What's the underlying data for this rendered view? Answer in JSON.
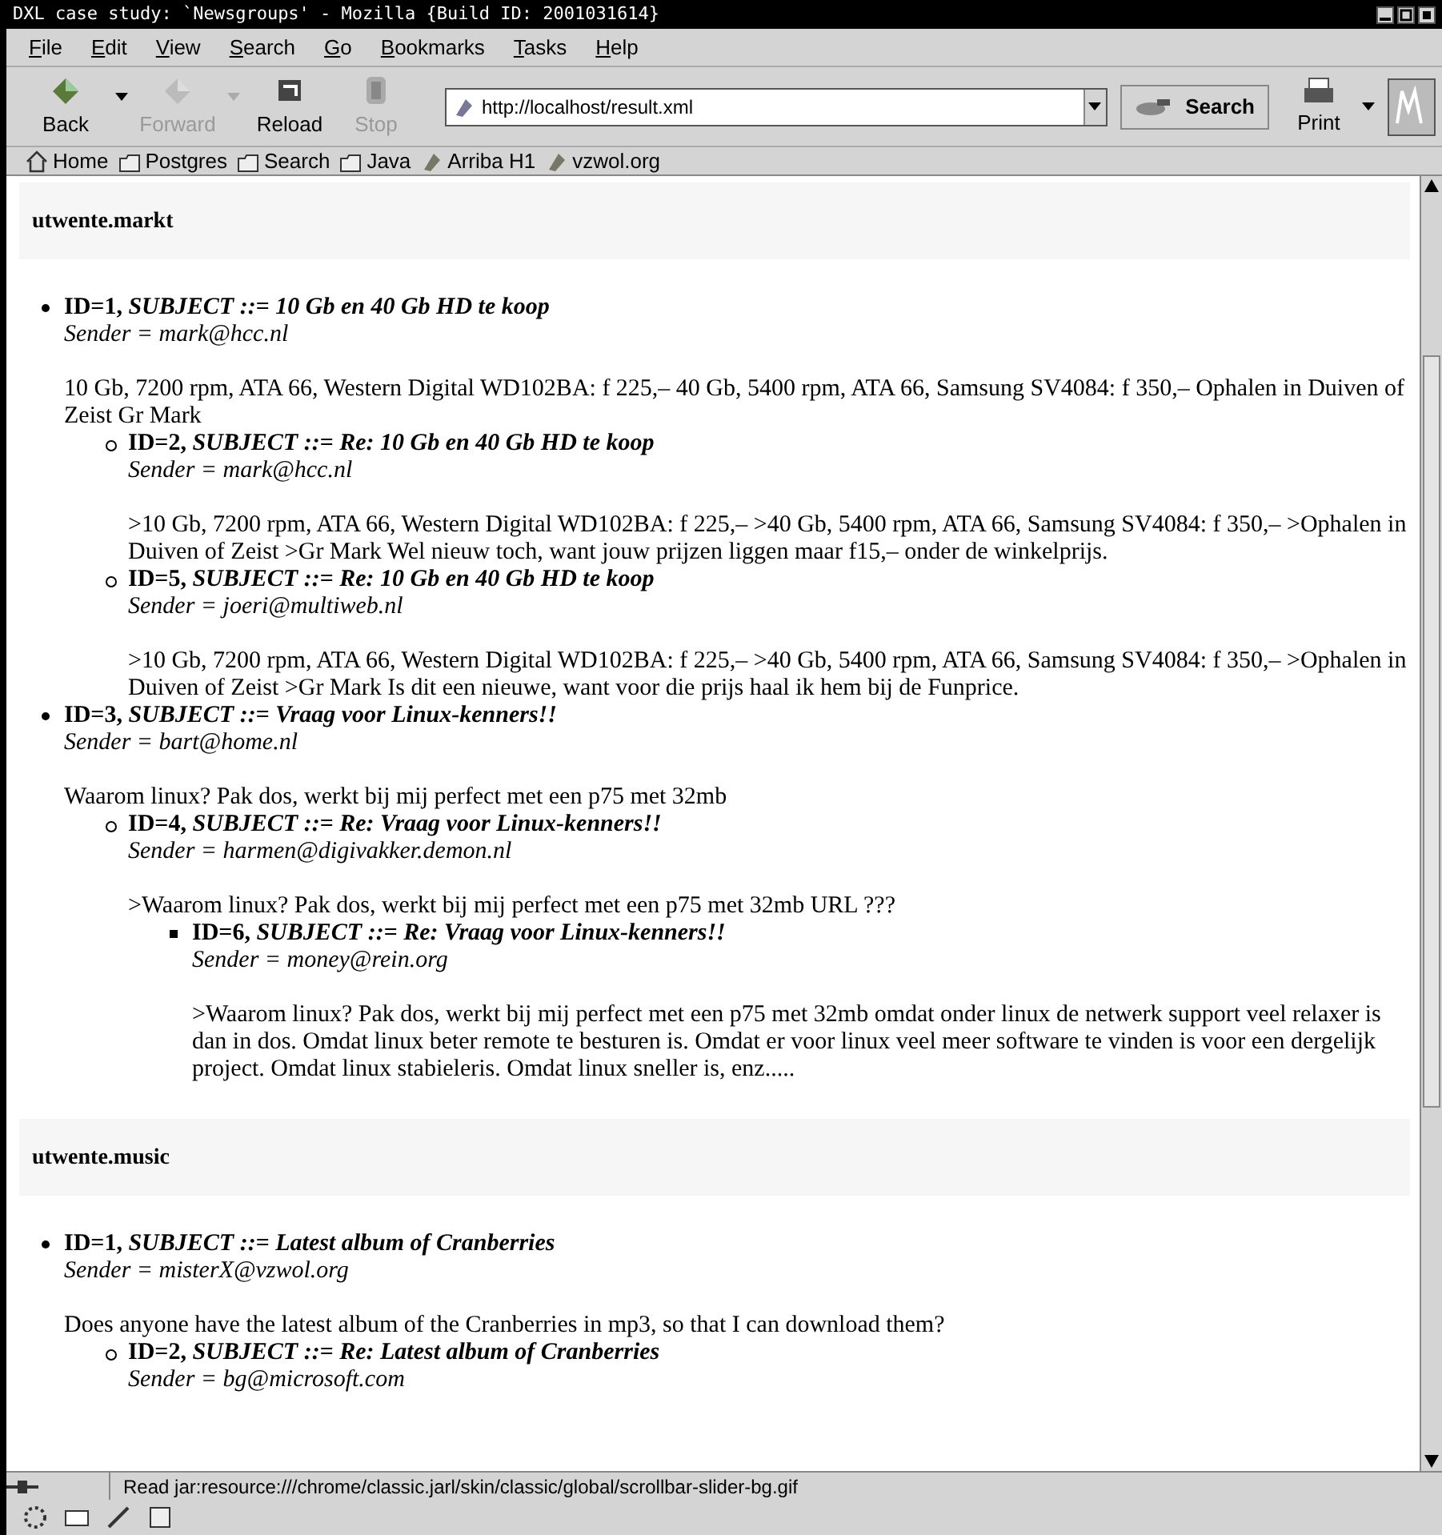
{
  "window": {
    "title": "DXL case study: `Newsgroups' - Mozilla {Build ID: 2001031614}"
  },
  "menu": [
    "File",
    "Edit",
    "View",
    "Search",
    "Go",
    "Bookmarks",
    "Tasks",
    "Help"
  ],
  "nav_buttons": [
    {
      "label": "Back",
      "kind": "back",
      "disabled": false,
      "dropdown": true
    },
    {
      "label": "Forward",
      "kind": "forward",
      "disabled": true,
      "dropdown": true
    },
    {
      "label": "Reload",
      "kind": "reload",
      "disabled": false,
      "dropdown": false
    },
    {
      "label": "Stop",
      "kind": "stop",
      "disabled": true,
      "dropdown": false
    }
  ],
  "url": "http://localhost/result.xml",
  "search_button": "Search",
  "print_button": "Print",
  "personal_toolbar": [
    {
      "label": "Home",
      "kind": "home"
    },
    {
      "label": "Postgres",
      "kind": "folder"
    },
    {
      "label": "Search",
      "kind": "folder"
    },
    {
      "label": "Java",
      "kind": "folder"
    },
    {
      "label": "Arriba H1",
      "kind": "link"
    },
    {
      "label": "vzwol.org",
      "kind": "link"
    }
  ],
  "groups": [
    {
      "name": "utwente.markt",
      "posts": [
        {
          "id": "ID=1,",
          "subject": "SUBJECT ::= 10 Gb en 40 Gb HD te koop",
          "sender": "Sender = mark@hcc.nl",
          "body": "10 Gb, 7200 rpm, ATA 66, Western Digital WD102BA: f 225,– 40 Gb, 5400 rpm, ATA 66, Samsung SV4084: f 350,– Ophalen in Duiven of Zeist Gr Mark",
          "children": [
            {
              "id": "ID=2,",
              "subject": "SUBJECT ::= Re: 10 Gb en 40 Gb HD te koop",
              "sender": "Sender = mark@hcc.nl",
              "body": ">10 Gb, 7200 rpm, ATA 66, Western Digital WD102BA: f 225,– >40 Gb, 5400 rpm, ATA 66, Samsung SV4084: f 350,– >Ophalen in Duiven of Zeist >Gr Mark Wel nieuw toch, want jouw prijzen liggen maar f15,– onder de winkelprijs."
            },
            {
              "id": "ID=5,",
              "subject": "SUBJECT ::= Re: 10 Gb en 40 Gb HD te koop",
              "sender": "Sender = joeri@multiweb.nl",
              "body": ">10 Gb, 7200 rpm, ATA 66, Western Digital WD102BA: f 225,– >40 Gb, 5400 rpm, ATA 66, Samsung SV4084: f 350,– >Ophalen in Duiven of Zeist >Gr Mark Is dit een nieuwe, want voor die prijs haal ik hem bij de Funprice."
            }
          ]
        },
        {
          "id": "ID=3,",
          "subject": "SUBJECT ::= Vraag voor Linux-kenners!!",
          "sender": "Sender = bart@home.nl",
          "body": "Waarom linux? Pak dos, werkt bij mij perfect met een p75 met 32mb",
          "children": [
            {
              "id": "ID=4,",
              "subject": "SUBJECT ::= Re: Vraag voor Linux-kenners!!",
              "sender": "Sender = harmen@digivakker.demon.nl",
              "body": ">Waarom linux? Pak dos, werkt bij mij perfect met een p75 met 32mb URL ???",
              "children": [
                {
                  "id": "ID=6,",
                  "subject": "SUBJECT ::= Re: Vraag voor Linux-kenners!!",
                  "sender": "Sender = money@rein.org",
                  "body": ">Waarom linux? Pak dos, werkt bij mij perfect met een p75 met 32mb omdat onder linux de netwerk support veel relaxer is dan in dos. Omdat linux beter remote te besturen is. Omdat er voor linux veel meer software te vinden is voor een dergelijk project. Omdat linux stabieleris. Omdat linux sneller is, enz....."
                }
              ]
            }
          ]
        }
      ]
    },
    {
      "name": "utwente.music",
      "posts": [
        {
          "id": "ID=1,",
          "subject": "SUBJECT ::= Latest album of Cranberries",
          "sender": "Sender = misterX@vzwol.org",
          "body": "Does anyone have the latest album of the Cranberries in mp3, so that I can download them?",
          "children": [
            {
              "id": "ID=2,",
              "subject": "SUBJECT ::= Re: Latest album of Cranberries",
              "sender": "Sender = bg@microsoft.com"
            }
          ]
        }
      ]
    }
  ],
  "status_bar": "Read jar:resource:///chrome/classic.jarl/skin/classic/global/scrollbar-slider-bg.gif"
}
